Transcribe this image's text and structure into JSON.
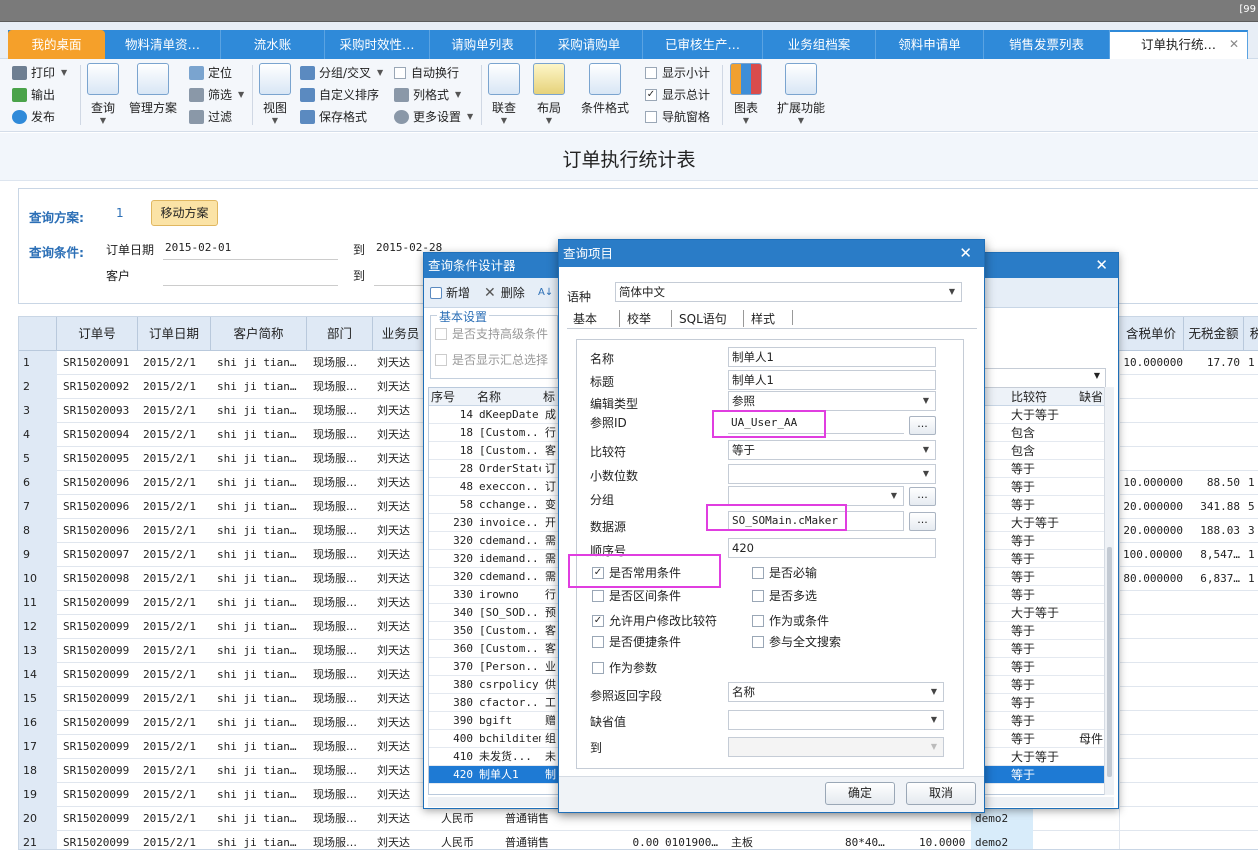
{
  "topbar": {
    "corner": "[99"
  },
  "tabs": [
    {
      "label": "我的桌面"
    },
    {
      "label": "物料清单资…"
    },
    {
      "label": "流水账"
    },
    {
      "label": "采购时效性…"
    },
    {
      "label": "请购单列表"
    },
    {
      "label": "采购请购单"
    },
    {
      "label": "已审核生产…"
    },
    {
      "label": "业务组档案"
    },
    {
      "label": "领料申请单"
    },
    {
      "label": "销售发票列表"
    },
    {
      "label": "订单执行统…"
    }
  ],
  "ribbon": {
    "print": "打印",
    "export": "输出",
    "publish": "发布",
    "query": "查询",
    "manage_plan": "管理方案",
    "locate": "定位",
    "filter_menu": "筛选",
    "filter": "过滤",
    "view": "视图",
    "group": "分组/交叉",
    "custom_sort": "自定义排序",
    "save_format": "保存格式",
    "auto_wrap": "自动换行",
    "col_format": "列格式",
    "more_settings": "更多设置",
    "link_query": "联查",
    "layout": "布局",
    "cond_format": "条件格式",
    "show_subtotal": "显示小计",
    "show_total": "显示总计",
    "nav_pane": "导航窗格",
    "chart": "图表",
    "extend": "扩展功能"
  },
  "page_title": "订单执行统计表",
  "query_panel": {
    "plan_label": "查询方案:",
    "plan_value": "1",
    "move_plan": "移动方案",
    "cond_label": "查询条件:",
    "order_date_label": "订单日期",
    "order_date_from": "2015-02-01",
    "to_label": "到",
    "order_date_to": "2015-02-28",
    "customer_label": "客户",
    "customer_to_label": "到"
  },
  "grid": {
    "headers": [
      "订单号",
      "订单日期",
      "客户简称",
      "部门",
      "业务员"
    ],
    "right_headers": [
      "含税单价",
      "无税金额",
      "税"
    ],
    "rows": [
      {
        "n": "1",
        "no": "SR15020091",
        "d": "2015/2/1",
        "c": "shi ji tian…",
        "dept": "现场服…",
        "emp": "刘天达",
        "p": "10.000000",
        "a": "17.70",
        "t": "1"
      },
      {
        "n": "2",
        "no": "SR15020092",
        "d": "2015/2/1",
        "c": "shi ji tian…",
        "dept": "现场服…",
        "emp": "刘天达",
        "p": "",
        "a": "",
        "t": ""
      },
      {
        "n": "3",
        "no": "SR15020093",
        "d": "2015/2/1",
        "c": "shi ji tian…",
        "dept": "现场服…",
        "emp": "刘天达",
        "p": "",
        "a": "",
        "t": ""
      },
      {
        "n": "4",
        "no": "SR15020094",
        "d": "2015/2/1",
        "c": "shi ji tian…",
        "dept": "现场服…",
        "emp": "刘天达",
        "p": "",
        "a": "",
        "t": ""
      },
      {
        "n": "5",
        "no": "SR15020095",
        "d": "2015/2/1",
        "c": "shi ji tian…",
        "dept": "现场服…",
        "emp": "刘天达",
        "p": "",
        "a": "",
        "t": ""
      },
      {
        "n": "6",
        "no": "SR15020096",
        "d": "2015/2/1",
        "c": "shi ji tian…",
        "dept": "现场服…",
        "emp": "刘天达",
        "p": "10.000000",
        "a": "88.50",
        "t": "1"
      },
      {
        "n": "7",
        "no": "SR15020096",
        "d": "2015/2/1",
        "c": "shi ji tian…",
        "dept": "现场服…",
        "emp": "刘天达",
        "p": "20.000000",
        "a": "341.88",
        "t": "5"
      },
      {
        "n": "8",
        "no": "SR15020096",
        "d": "2015/2/1",
        "c": "shi ji tian…",
        "dept": "现场服…",
        "emp": "刘天达",
        "p": "20.000000",
        "a": "188.03",
        "t": "3"
      },
      {
        "n": "9",
        "no": "SR15020097",
        "d": "2015/2/1",
        "c": "shi ji tian…",
        "dept": "现场服…",
        "emp": "刘天达",
        "p": "100.000000",
        "a": "8,547…",
        "t": "1"
      },
      {
        "n": "10",
        "no": "SR15020098",
        "d": "2015/2/1",
        "c": "shi ji tian…",
        "dept": "现场服…",
        "emp": "刘天达",
        "p": "80.000000",
        "a": "6,837…",
        "t": "1"
      },
      {
        "n": "11",
        "no": "SR15020099",
        "d": "2015/2/1",
        "c": "shi ji tian…",
        "dept": "现场服…",
        "emp": "刘天达",
        "p": "",
        "a": "",
        "t": ""
      },
      {
        "n": "12",
        "no": "SR15020099",
        "d": "2015/2/1",
        "c": "shi ji tian…",
        "dept": "现场服…",
        "emp": "刘天达",
        "p": "",
        "a": "",
        "t": ""
      },
      {
        "n": "13",
        "no": "SR15020099",
        "d": "2015/2/1",
        "c": "shi ji tian…",
        "dept": "现场服…",
        "emp": "刘天达",
        "p": "",
        "a": "",
        "t": ""
      },
      {
        "n": "14",
        "no": "SR15020099",
        "d": "2015/2/1",
        "c": "shi ji tian…",
        "dept": "现场服…",
        "emp": "刘天达",
        "p": "",
        "a": "",
        "t": ""
      },
      {
        "n": "15",
        "no": "SR15020099",
        "d": "2015/2/1",
        "c": "shi ji tian…",
        "dept": "现场服…",
        "emp": "刘天达",
        "p": "",
        "a": "",
        "t": ""
      },
      {
        "n": "16",
        "no": "SR15020099",
        "d": "2015/2/1",
        "c": "shi ji tian…",
        "dept": "现场服…",
        "emp": "刘天达",
        "p": "",
        "a": "",
        "t": ""
      },
      {
        "n": "17",
        "no": "SR15020099",
        "d": "2015/2/1",
        "c": "shi ji tian…",
        "dept": "现场服…",
        "emp": "刘天达",
        "p": "",
        "a": "",
        "t": ""
      },
      {
        "n": "18",
        "no": "SR15020099",
        "d": "2015/2/1",
        "c": "shi ji tian…",
        "dept": "现场服…",
        "emp": "刘天达",
        "p": "",
        "a": "",
        "t": ""
      },
      {
        "n": "19",
        "no": "SR15020099",
        "d": "2015/2/1",
        "c": "shi ji tian…",
        "dept": "现场服…",
        "emp": "刘天达",
        "p": "",
        "a": "",
        "t": ""
      },
      {
        "n": "20",
        "no": "SR15020099",
        "d": "2015/2/1",
        "c": "shi ji tian…",
        "dept": "现场服…",
        "emp": "刘天达",
        "p": "",
        "a": "",
        "t": ""
      },
      {
        "n": "21",
        "no": "SR15020099",
        "d": "2015/2/1",
        "c": "shi ji tian…",
        "dept": "现场服…",
        "emp": "刘天达",
        "p": "",
        "a": "",
        "t": ""
      }
    ],
    "tail_row20": {
      "cur": "人民币",
      "type": "普通销售",
      "amt": "0.00",
      "code": "0101900…",
      "item": "主板",
      "spec": "80*40…",
      "qty": "10.0000",
      "who": "demo2"
    },
    "tail_row21": {
      "cur": "人民币",
      "type": "普通销售",
      "amt": "0.00",
      "code": "0101900…",
      "item": "主板",
      "spec": "80*40…",
      "qty": "10.0000",
      "who": "demo2"
    },
    "partial_20": {
      "amt": "0.00",
      "code": "0101000",
      "item": "主板",
      "spec": "00*40",
      "qty": "10.0000",
      "who": "demo2"
    }
  },
  "designer": {
    "title": "查询条件设计器",
    "add": "新增",
    "delete": "删除",
    "group_title": "基本设置",
    "support_adv": "是否支持高级条件",
    "show_summary": "是否显示汇总选择",
    "col_seq": "序号",
    "col_name": "名称",
    "col_title": "标",
    "rows": [
      {
        "seq": "14",
        "name": "dKeepDate",
        "t": "成"
      },
      {
        "seq": "18",
        "name": "[Custom...",
        "t": "行"
      },
      {
        "seq": "18",
        "name": "[Custom...",
        "t": "客"
      },
      {
        "seq": "28",
        "name": "OrderState",
        "t": "订"
      },
      {
        "seq": "48",
        "name": "execcon...",
        "t": "订"
      },
      {
        "seq": "58",
        "name": "cchange...",
        "t": "变"
      },
      {
        "seq": "230",
        "name": "invoice...",
        "t": "开"
      },
      {
        "seq": "320",
        "name": "cdemand...",
        "t": "需"
      },
      {
        "seq": "320",
        "name": "idemand...",
        "t": "需"
      },
      {
        "seq": "320",
        "name": "cdemand...",
        "t": "需"
      },
      {
        "seq": "330",
        "name": "irowno",
        "t": "行"
      },
      {
        "seq": "340",
        "name": "[SO_SOD...",
        "t": "预"
      },
      {
        "seq": "350",
        "name": "[Custom...",
        "t": "客"
      },
      {
        "seq": "360",
        "name": "[Custom...",
        "t": "客"
      },
      {
        "seq": "370",
        "name": "[Person...",
        "t": "业"
      },
      {
        "seq": "380",
        "name": "csrpolicy",
        "t": "供"
      },
      {
        "seq": "380",
        "name": "cfactor...",
        "t": "工"
      },
      {
        "seq": "390",
        "name": "bgift",
        "t": "赠"
      },
      {
        "seq": "400",
        "name": "bchilditem",
        "t": "组"
      },
      {
        "seq": "410",
        "name": "未发货...",
        "t": "未"
      },
      {
        "seq": "420",
        "name": "制单人1",
        "t": "制"
      }
    ],
    "right_col_cmp": "比较符",
    "right_col_default": "缺省",
    "right_rows": [
      "大于等于",
      "包含",
      "包含",
      "等于",
      "等于",
      "等于",
      "大于等于",
      "等于",
      "等于",
      "等于",
      "等于",
      "大于等于",
      "等于",
      "等于",
      "等于",
      "等于",
      "等于",
      "等于",
      "等于",
      "大于等于",
      "等于"
    ],
    "right_extra": {
      "row": 18,
      "text": "母件"
    }
  },
  "item_dialog": {
    "title": "查询项目",
    "lang_label": "语种",
    "lang_value": "简体中文",
    "tabs": [
      "基本",
      "校举",
      "SQL语句",
      "样式"
    ],
    "name_label": "名称",
    "name_value": "制单人1",
    "title_label": "标题",
    "title_value": "制单人1",
    "edit_type_label": "编辑类型",
    "edit_type_value": "参照",
    "ref_id_label": "参照ID",
    "ref_id_value": "UA_User_AA",
    "cmp_label": "比较符",
    "cmp_value": "等于",
    "decimal_label": "小数位数",
    "decimal_value": "",
    "group_label": "分组",
    "group_value": "",
    "datasource_label": "数据源",
    "datasource_value": "SO_SOMain.cMaker",
    "order_label": "顺序号",
    "order_value": "420",
    "chk_common": "是否常用条件",
    "chk_required": "是否必输",
    "chk_range": "是否区间条件",
    "chk_multi": "是否多选",
    "chk_modify_cmp": "允许用户修改比较符",
    "chk_or": "作为或条件",
    "chk_quick": "是否便捷条件",
    "chk_fulltext": "参与全文搜索",
    "chk_param": "作为参数",
    "ref_return_label": "参照返回字段",
    "ref_return_value": "名称",
    "default_label": "缺省值",
    "default_value": "",
    "to_label": "到",
    "to_value": "",
    "ok": "确定",
    "cancel": "取消",
    "ellipsis": "..."
  }
}
